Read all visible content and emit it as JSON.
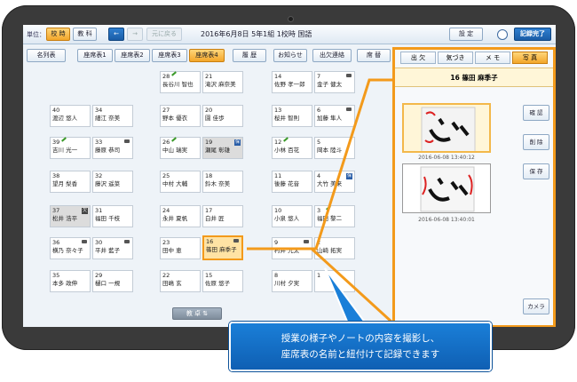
{
  "topbar": {
    "unit_label": "単位：",
    "btn_teacher": "校 時",
    "btn_subject": "教 科",
    "btn_prev": "←",
    "btn_next": "→",
    "btn_restore": "元に戻る",
    "title": "2016年6月8日 5年1組 1校時 国語",
    "btn_settings": "設 定",
    "btn_done": "記録完了"
  },
  "tabs": {
    "list": "名列表",
    "seat1": "座席表1",
    "seat2": "座席表2",
    "seat3": "座席表3",
    "seat4": "座席表4",
    "history": "履 歴",
    "notice": "お知らせ",
    "attendance": "出欠連絡",
    "swap": "席 替"
  },
  "seats": {
    "s28": {
      "num": "28",
      "name": "長谷川 智也"
    },
    "s21": {
      "num": "21",
      "name": "滝沢 麻奈美"
    },
    "s14": {
      "num": "14",
      "name": "佐野 孝一郎"
    },
    "s7": {
      "num": "7",
      "name": "金子 健太"
    },
    "s40": {
      "num": "40",
      "name": "渡辺 悠人"
    },
    "s34": {
      "num": "34",
      "name": "細江 奈美"
    },
    "s27": {
      "num": "27",
      "name": "野本 優衣"
    },
    "s20": {
      "num": "20",
      "name": "園 佳歩"
    },
    "s13": {
      "num": "13",
      "name": "桜井 智則"
    },
    "s6": {
      "num": "6",
      "name": "加藤 隼人"
    },
    "s39": {
      "num": "39",
      "name": "吉川 光一"
    },
    "s33": {
      "num": "33",
      "name": "藤原 恭司"
    },
    "s26": {
      "num": "26",
      "name": "中山 瑞実"
    },
    "s19": {
      "num": "19",
      "name": "瀬尾 彰雄"
    },
    "s12": {
      "num": "12",
      "name": "小林 百花"
    },
    "s5": {
      "num": "5",
      "name": "岡本 陸斗"
    },
    "s38": {
      "num": "38",
      "name": "望月 梨香"
    },
    "s32": {
      "num": "32",
      "name": "藤沢 遥菜"
    },
    "s25": {
      "num": "25",
      "name": "中村 大輔"
    },
    "s18": {
      "num": "18",
      "name": "鈴木 奈美"
    },
    "s11": {
      "num": "11",
      "name": "後藤 花音"
    },
    "s4": {
      "num": "4",
      "name": "大竹 美来"
    },
    "s37": {
      "num": "37",
      "name": "松井 浩平"
    },
    "s31": {
      "num": "31",
      "name": "福田 千枝"
    },
    "s24": {
      "num": "24",
      "name": "永井 夏帆"
    },
    "s17": {
      "num": "17",
      "name": "白井 匠"
    },
    "s10": {
      "num": "10",
      "name": "小泉 悠人"
    },
    "s3": {
      "num": "3",
      "name": "福田 黎二"
    },
    "s36": {
      "num": "36",
      "name": "横乃 奈々子"
    },
    "s30": {
      "num": "30",
      "name": "平井 藍子"
    },
    "s23": {
      "num": "23",
      "name": "田中 恵"
    },
    "s16": {
      "num": "16",
      "name": "篠田 麻季子"
    },
    "s9": {
      "num": "9",
      "name": "村井 光太"
    },
    "s2": {
      "num": "2",
      "name": "山崎 拓実"
    },
    "s35": {
      "num": "35",
      "name": "本多 政伸"
    },
    "s29": {
      "num": "29",
      "name": "樋口 一規"
    },
    "s22": {
      "num": "22",
      "name": "田嶋 玄"
    },
    "s15": {
      "num": "15",
      "name": "佐原 悠子"
    },
    "s8": {
      "num": "8",
      "name": "川村 夕実"
    },
    "s1": {
      "num": "1",
      "name": ""
    }
  },
  "podium_label": "教 卓 ⇅",
  "panel": {
    "tab_attend": "出 欠",
    "tab_notice": "気づき",
    "tab_memo": "メ モ",
    "tab_photo": "写 真",
    "student": "16 篠田 麻季子",
    "photo1_time": "2016-06-08 13:40:12",
    "photo2_time": "2016-06-08 13:40:01",
    "btn_confirm": "確 認",
    "btn_delete": "削 除",
    "btn_save": "保 存",
    "btn_camera": "カメラ"
  },
  "callout": {
    "line1": "授業の様子やノートの内容を撮影し、",
    "line2": "座席表の名前と紐付けて記録できます"
  },
  "colors": {
    "accent": "#f39a1b",
    "primary": "#1a6fc9",
    "bezel": "#3a3a3a"
  }
}
